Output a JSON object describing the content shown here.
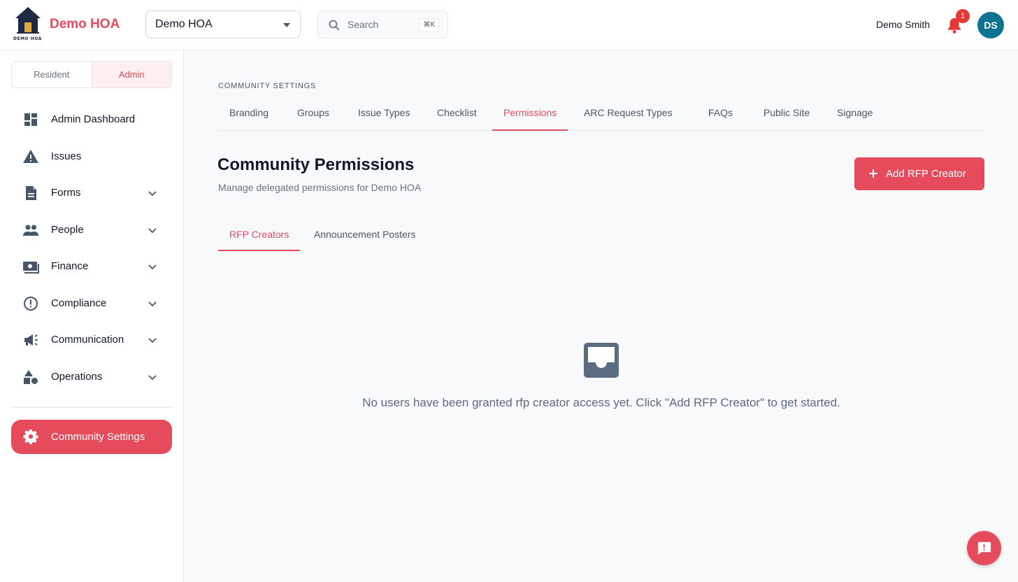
{
  "header": {
    "brand": "Demo HOA",
    "logo_text": "DEMO HOA",
    "hoa_select_value": "Demo HOA",
    "search_placeholder": "Search",
    "search_shortcut": "⌘K",
    "user_name": "Demo Smith",
    "notification_count": "1",
    "avatar_initials": "DS"
  },
  "sidebar": {
    "mode_resident": "Resident",
    "mode_admin": "Admin",
    "items": [
      {
        "label": "Admin Dashboard",
        "icon": "dashboard-icon"
      },
      {
        "label": "Issues",
        "icon": "warning-icon"
      },
      {
        "label": "Forms",
        "icon": "document-icon"
      },
      {
        "label": "People",
        "icon": "people-icon"
      },
      {
        "label": "Finance",
        "icon": "money-icon"
      },
      {
        "label": "Compliance",
        "icon": "alert-circle-icon"
      },
      {
        "label": "Communication",
        "icon": "megaphone-icon"
      },
      {
        "label": "Operations",
        "icon": "shapes-icon"
      }
    ],
    "active_item": "Community Settings"
  },
  "main": {
    "section_label": "COMMUNITY SETTINGS",
    "tabs": [
      "Branding",
      "Groups",
      "Issue Types",
      "Checklist",
      "Permissions",
      "ARC Request Types",
      "FAQs",
      "Public Site",
      "Signage"
    ],
    "active_tab": "Permissions",
    "title": "Community Permissions",
    "subtitle": "Manage delegated permissions for Demo HOA",
    "add_button": "Add RFP Creator",
    "subtabs": [
      "RFP Creators",
      "Announcement Posters"
    ],
    "active_subtab": "RFP Creators",
    "empty_message": "No users have been granted rfp creator access yet. Click \"Add RFP Creator\" to get started."
  },
  "colors": {
    "accent": "#e54b5b",
    "avatar": "#0e7490",
    "icon_gray": "#475569"
  }
}
